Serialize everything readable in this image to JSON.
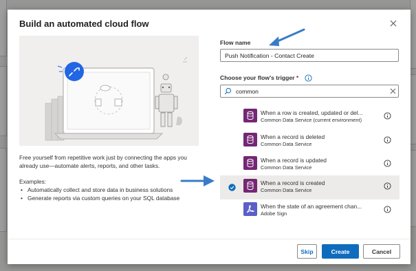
{
  "dialog": {
    "title": "Build an automated cloud flow",
    "description": "Free yourself from repetitive work just by connecting the apps you already use—automate alerts, reports, and other tasks.",
    "examples_label": "Examples:",
    "examples": [
      "Automatically collect and store data in business solutions",
      "Generate reports via custom queries on your SQL database"
    ]
  },
  "form": {
    "flow_name_label": "Flow name",
    "flow_name_value": "Push Notification - Contact Create",
    "trigger_label": "Choose your flow's trigger",
    "required_mark": "*",
    "search_value": "common"
  },
  "triggers": [
    {
      "title": "When a row is created, updated or del...",
      "subtitle": "Common Data Service (current environment)",
      "icon": "database-icon",
      "color": "#742774",
      "selected": false
    },
    {
      "title": "When a record is deleted",
      "subtitle": "Common Data Service",
      "icon": "database-icon",
      "color": "#742774",
      "selected": false
    },
    {
      "title": "When a record is updated",
      "subtitle": "Common Data Service",
      "icon": "database-icon",
      "color": "#742774",
      "selected": false
    },
    {
      "title": "When a record is created",
      "subtitle": "Common Data Service",
      "icon": "database-icon",
      "color": "#742774",
      "selected": true
    },
    {
      "title": "When the state of an agreement chan...",
      "subtitle": "Adobe Sign",
      "icon": "adobe-sign-icon",
      "color": "#5b5fc7",
      "selected": false
    }
  ],
  "buttons": {
    "skip": "Skip",
    "create": "Create",
    "cancel": "Cancel"
  },
  "colors": {
    "accent": "#0f6cbd",
    "cds_purple": "#742774",
    "adobe": "#5b5fc7",
    "arrow": "#3a7bc8"
  }
}
